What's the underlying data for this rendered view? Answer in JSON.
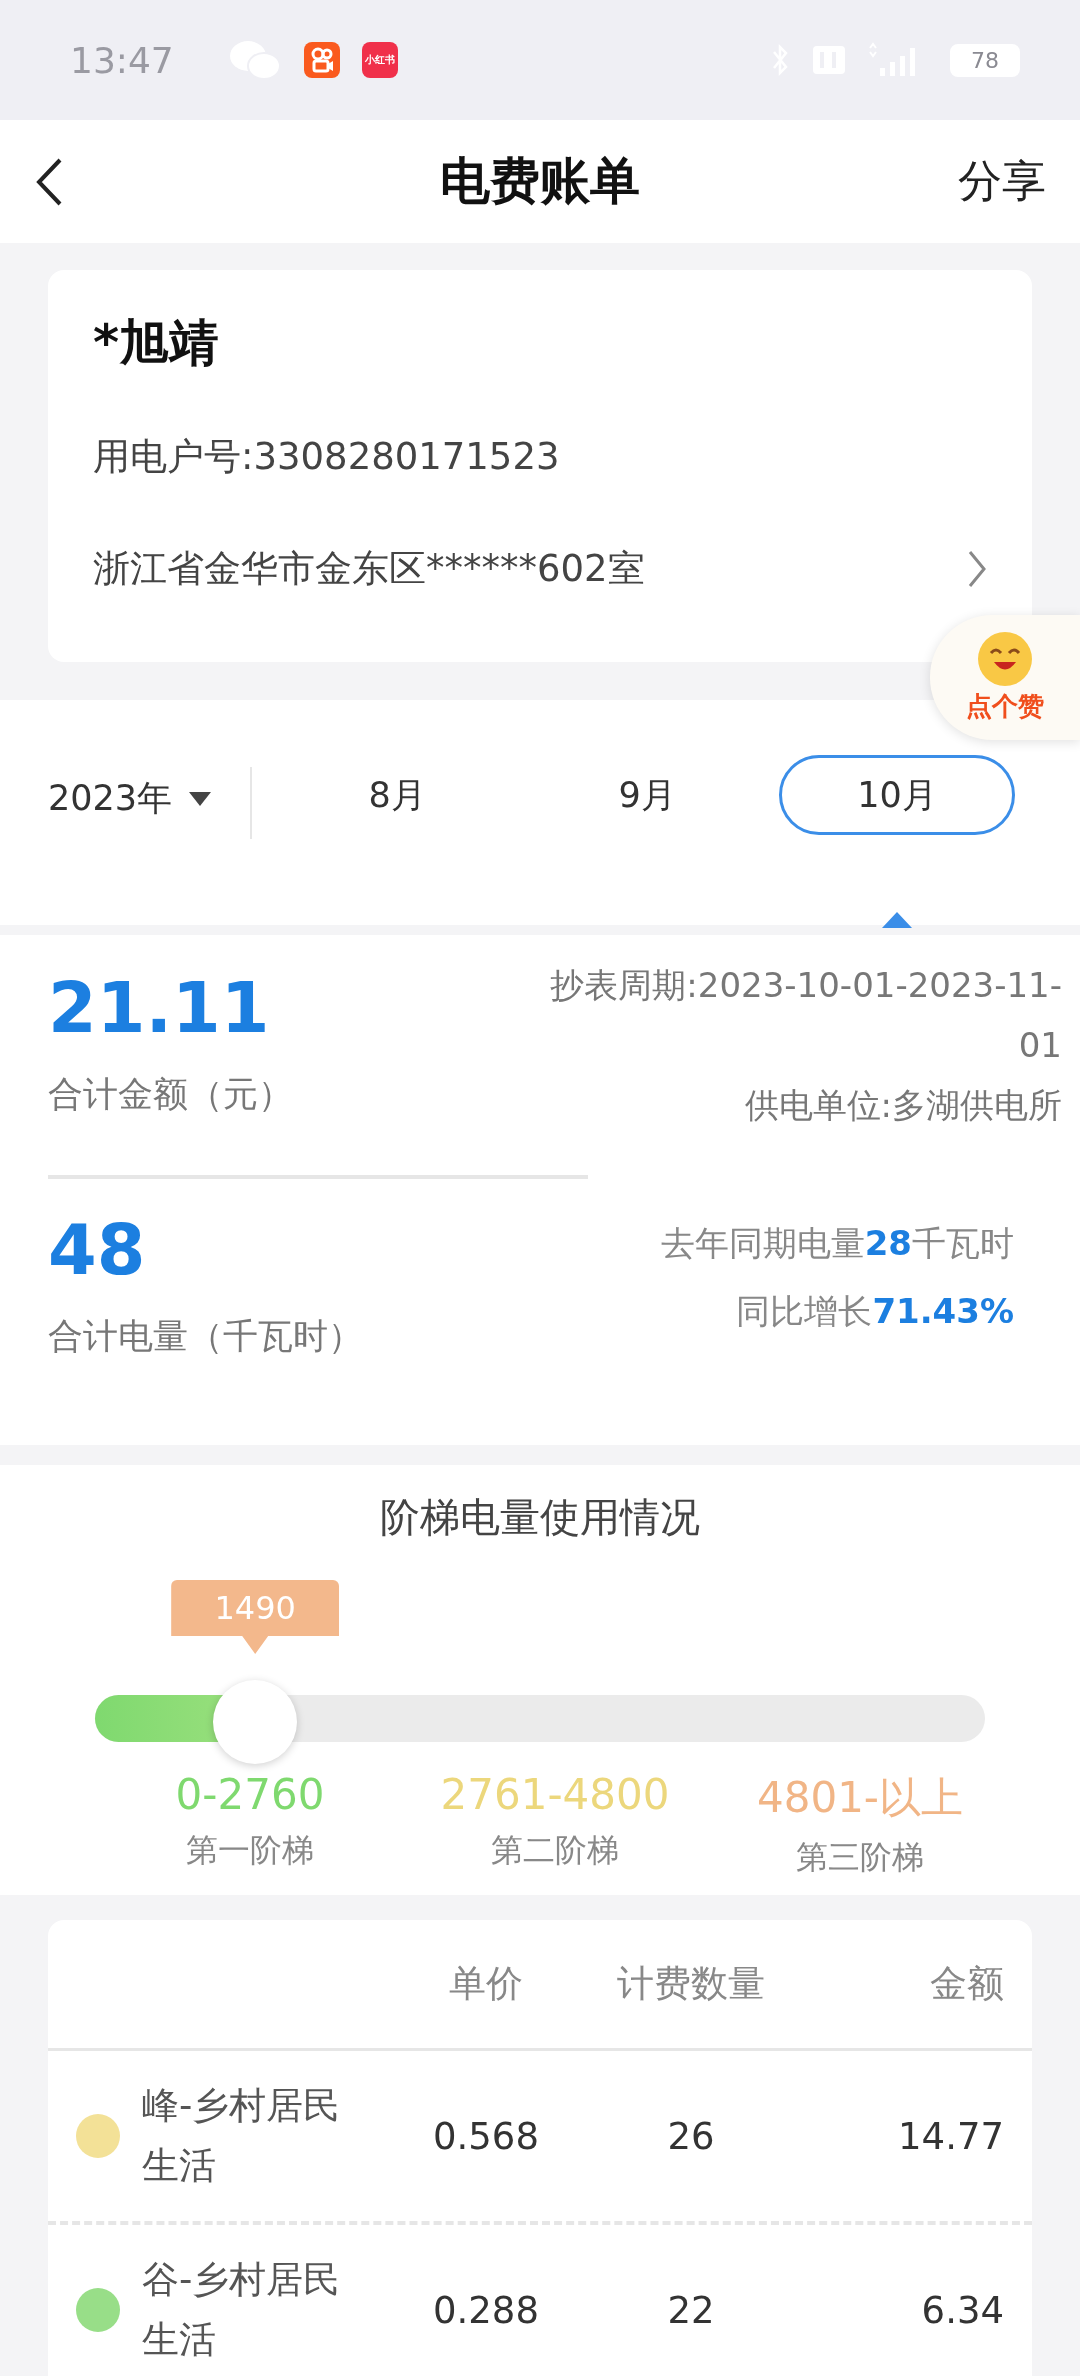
{
  "status_bar": {
    "time": "13:47",
    "app_icons": [
      {
        "kind": "chat"
      },
      {
        "kind": "video"
      },
      {
        "kind": "text",
        "label": "小红书"
      }
    ],
    "battery": "78"
  },
  "header": {
    "title": "电费账单",
    "action": "分享"
  },
  "account": {
    "name": "*旭靖",
    "number": "用电户号:3308280171523",
    "address": "浙江省金华市金东区******602室"
  },
  "like_badge": {
    "label": "点个赞"
  },
  "period": {
    "year": "2023年",
    "months": [
      {
        "label": "8月",
        "selected": false
      },
      {
        "label": "9月",
        "selected": false
      },
      {
        "label": "10月",
        "selected": true
      }
    ]
  },
  "summary": {
    "amount": "21.11",
    "amount_label": "合计金额（元）",
    "meter_period": "抄表周期:2023-10-01-2023-11-01",
    "supplier": "供电单位:多湖供电所",
    "usage": "48",
    "usage_label": "合计电量（千瓦时）",
    "last_year": "去年同期电量**28**千瓦时",
    "growth": "同比增长**71.43%**"
  },
  "tiers": {
    "title": "阶梯电量使用情况",
    "reading": "1490",
    "level": 0.18,
    "items": [
      {
        "range": "0-2760",
        "name": "第一阶梯",
        "color": "#7fd96f"
      },
      {
        "range": "2761-4800",
        "name": "第二阶梯",
        "color": "#ecd77c"
      },
      {
        "range": "4801-以上",
        "name": "第三阶梯",
        "color": "#f1b586"
      }
    ]
  },
  "table": {
    "columns": [
      "单价",
      "计费数量",
      "金额"
    ],
    "rows": [
      {
        "color": "#f3e197",
        "name": "峰-乡村居民生活",
        "price": "0.568",
        "quantity": "26",
        "amount": "14.77"
      },
      {
        "color": "#98de88",
        "name": "谷-乡村居民生活",
        "price": "0.288",
        "quantity": "22",
        "amount": "6.34"
      }
    ]
  }
}
